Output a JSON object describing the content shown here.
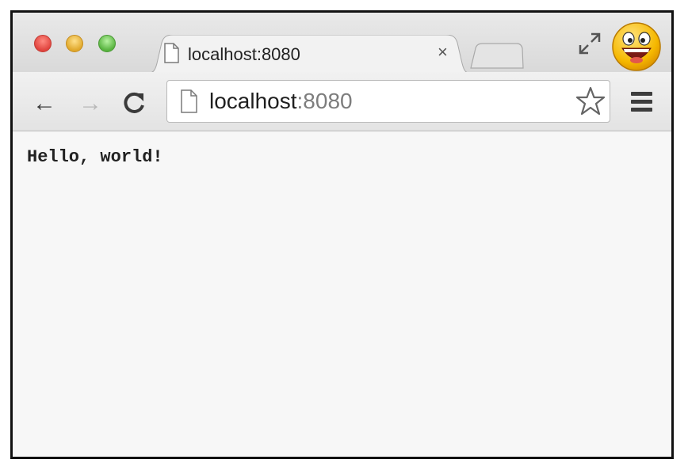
{
  "tab": {
    "title": "localhost:8080",
    "close_glyph": "×"
  },
  "toolbar": {
    "back_glyph": "←",
    "forward_glyph": "→"
  },
  "omnibox": {
    "host": "localhost",
    "port": ":8080"
  },
  "page": {
    "text": "Hello, world!"
  },
  "icons": {
    "traffic_lights": [
      "close-icon",
      "minimize-icon",
      "maximize-icon"
    ],
    "tab": "page-icon",
    "fullscreen": "fullscreen-icon",
    "profile": "smiley-avatar-icon",
    "reload": "reload-icon",
    "bookmark": "star-icon",
    "menu": "hamburger-menu-icon"
  },
  "colors": {
    "close": "#e0443e",
    "minimize": "#e0a82b",
    "maximize": "#58b33f",
    "avatar": "#f5b800",
    "url_host": "#1f1f1f",
    "url_port": "#7d7d7d"
  }
}
